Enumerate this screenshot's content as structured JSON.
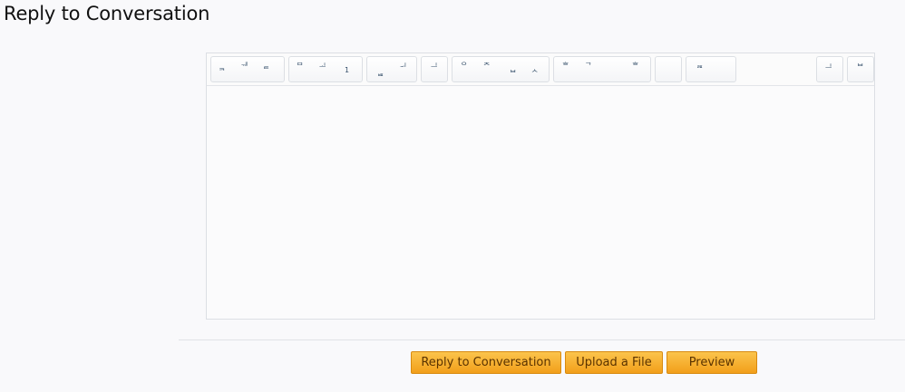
{
  "page": {
    "title": "Reply to Conversation"
  },
  "toolbar": {
    "groups": [
      {
        "name": "format-group",
        "buttons": [
          "ᆿ",
          "ᅰ",
          "ᇀ"
        ]
      },
      {
        "name": "list-group",
        "buttons": [
          "ᄆ",
          "ᆚ",
          "1"
        ]
      },
      {
        "name": "link-group",
        "buttons": [
          "ᇤ",
          "ᅱ"
        ]
      },
      {
        "name": "unlink-group",
        "buttons": [
          "ᆜ"
        ]
      },
      {
        "name": "media-group",
        "buttons": [
          "ᄋ",
          "ᄌ",
          "ᄇ",
          "ᄉ"
        ]
      },
      {
        "name": "code-group",
        "buttons": [
          "ᄒ",
          "ᄀ",
          "ᄒ"
        ]
      },
      {
        "name": "empty-group",
        "buttons": []
      },
      {
        "name": "misc-group",
        "buttons": [
          "ᆵ"
        ]
      },
      {
        "name": "undo-group",
        "buttons": [
          "ᆜ"
        ]
      },
      {
        "name": "redo-group",
        "buttons": [
          "ᄇ"
        ]
      }
    ]
  },
  "editor": {
    "content": ""
  },
  "actions": {
    "reply_label": "Reply to Conversation",
    "upload_label": "Upload a File",
    "preview_label": "Preview"
  }
}
